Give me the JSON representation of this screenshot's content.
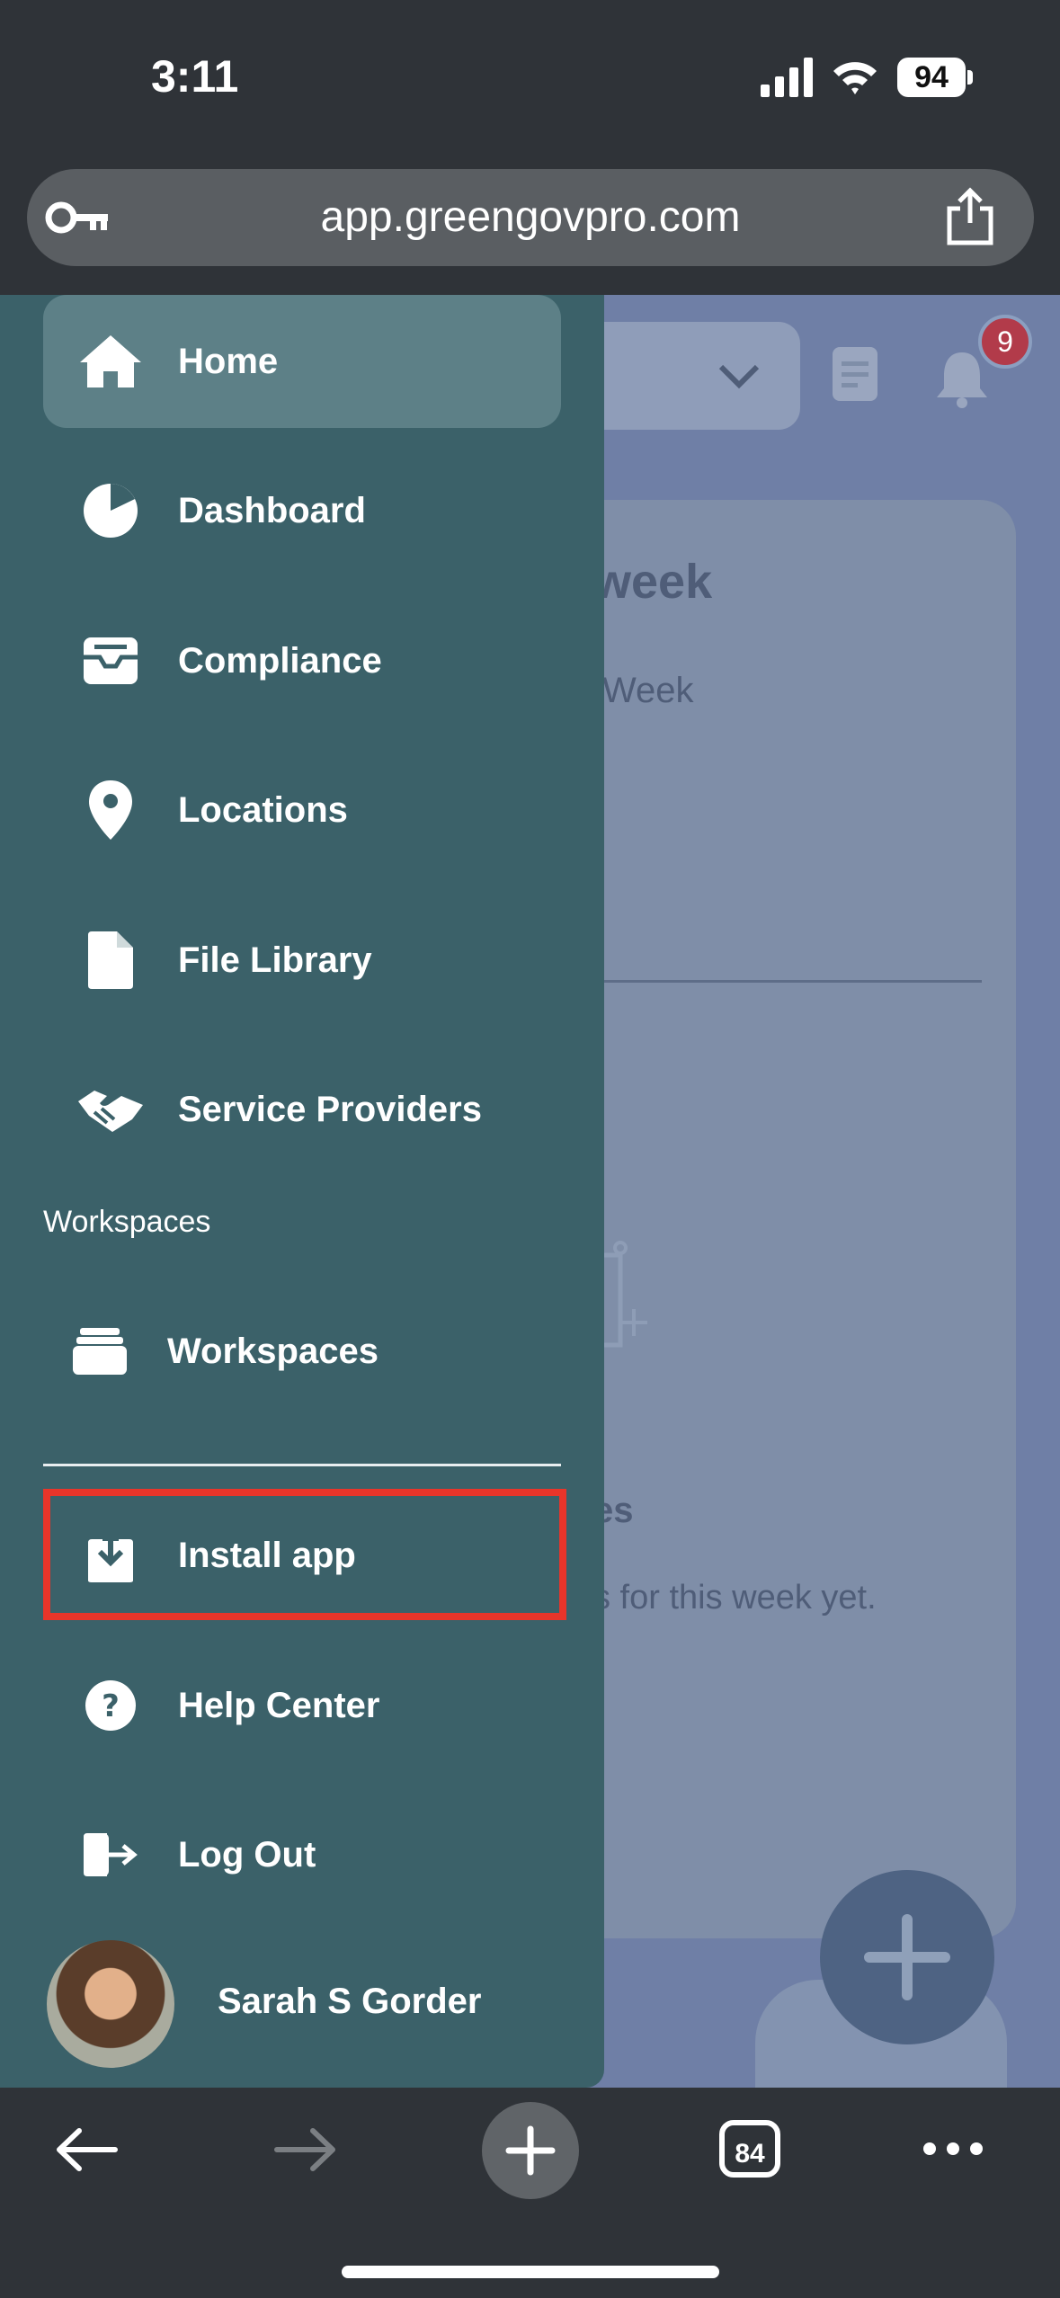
{
  "status_bar": {
    "time": "3:11",
    "battery": "94"
  },
  "browser": {
    "url": "app.greengovpro.com",
    "tab_count": "84"
  },
  "background_page": {
    "notification_count": "9",
    "card_title_fragment": "week",
    "tab_fragment": "Week",
    "empty_title_fragment": "es",
    "empty_text_fragment": "s for this week yet."
  },
  "drawer": {
    "items": [
      {
        "label": "Home",
        "icon": "home-icon"
      },
      {
        "label": "Dashboard",
        "icon": "pie-chart-icon"
      },
      {
        "label": "Compliance",
        "icon": "inbox-icon"
      },
      {
        "label": "Locations",
        "icon": "map-pin-icon"
      },
      {
        "label": "File Library",
        "icon": "file-icon"
      },
      {
        "label": "Service Providers",
        "icon": "handshake-icon"
      }
    ],
    "workspaces_heading": "Workspaces",
    "workspaces_item": "Workspaces",
    "install_app": "Install app",
    "help_center": "Help Center",
    "log_out": "Log Out",
    "user_name": "Sarah S Gorder"
  },
  "colors": {
    "drawer": "#3b6169",
    "active_item": "#5d8087",
    "highlight": "#e8352a",
    "page": "#6f7fa6"
  }
}
